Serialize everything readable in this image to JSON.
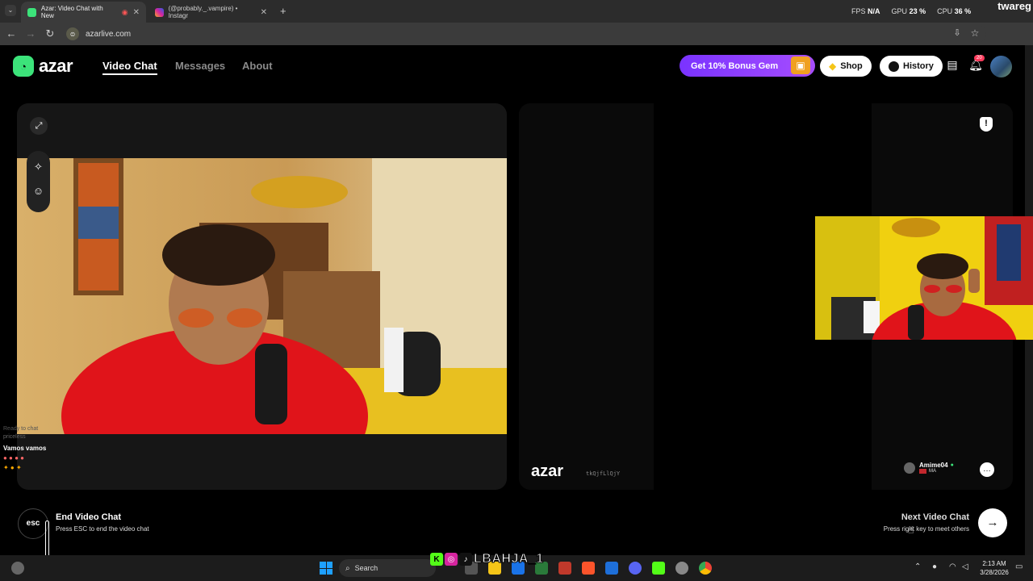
{
  "browser": {
    "tabs": [
      {
        "title": "Azar: Video Chat with New",
        "active": true
      },
      {
        "title": "(@probably._.vampire) • Instagr",
        "active": false
      }
    ],
    "url": "azarlive.com",
    "perf": {
      "fps_label": "FPS",
      "fps_value": "N/A",
      "gpu_label": "GPU",
      "gpu_value": "23 %",
      "cpu_label": "CPU",
      "cpu_value": "36 %"
    },
    "watermark": "twareg"
  },
  "site": {
    "logo_text": "azar",
    "nav": [
      {
        "label": "Video Chat",
        "active": true
      },
      {
        "label": "Messages",
        "active": false
      },
      {
        "label": "About",
        "active": false
      }
    ],
    "promo_label": "Get 10% Bonus Gem",
    "shop_label": "Shop",
    "history_label": "History",
    "notification_count": "20"
  },
  "local": {
    "chat": {
      "faded_lines": [
        "Ready to chat",
        "priceless"
      ],
      "message": "Vamos vamos"
    }
  },
  "remote": {
    "watermark_logo": "azar",
    "id_text": "tkQjfLlQjY",
    "username": "Amime04",
    "country": "MA"
  },
  "footer": {
    "esc_key": "esc",
    "end_title": "End Video Chat",
    "end_sub": "Press ESC to end the video chat",
    "next_title": "Next Video Chat",
    "next_sub": "Press right key to meet others"
  },
  "taskbar": {
    "search_placeholder": "Search",
    "overlay_handle": "LBAHJA_1",
    "time": "2:13 AM",
    "date": "3/28/2026"
  },
  "colors": {
    "accent_green": "#3ce37a",
    "promo_purple": "#8a3cff",
    "remote_shirt_red": "#e0141a"
  }
}
